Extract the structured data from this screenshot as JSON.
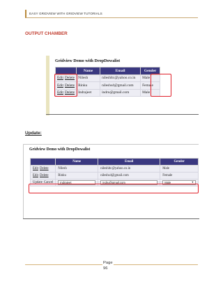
{
  "header": {
    "text": "EASY GRIDVIEW WITH GRIDVIEW TUTORIALS"
  },
  "output_section": {
    "title": "OUTPUT CHAMBER"
  },
  "update_section": {
    "title": "Update:"
  },
  "grid1": {
    "title": "Gridview Demo with DropDowalist",
    "columns": [
      "Name",
      "Email",
      "Gender"
    ],
    "rows": [
      {
        "edit": "Edit",
        "delete": "Delete",
        "name": "Nilesh",
        "email": "nileshltc@yahoo.co.in",
        "gender": "Male"
      },
      {
        "edit": "Edit",
        "delete": "Delete",
        "name": "Rinku",
        "email": "nileshs4@gmail.com",
        "gender": "Female"
      },
      {
        "edit": "Edit",
        "delete": "Delete",
        "name": "Indrajeet",
        "email": "indru@gmail.com",
        "gender": "Male"
      }
    ]
  },
  "grid2": {
    "title": "Gridview Demo with DropDowalist",
    "columns": [
      "Name",
      "Email",
      "Gender"
    ],
    "rows": [
      {
        "edit": "Edit",
        "delete": "Delete",
        "name": "Nilesh",
        "email": "nileshltc@yahoo.co.in",
        "gender": "Male"
      },
      {
        "edit": "Edit",
        "delete": "Delete",
        "name": "Rinku",
        "email": "nileshs4@gmail.com",
        "gender": "Female"
      }
    ],
    "edit_row": {
      "update": "Update",
      "cancel": "Cancel",
      "name": "Indrajeet",
      "email": "indru@gmail.com",
      "gender": "Male"
    }
  },
  "footer": {
    "page_label": "Page",
    "page_number": "96"
  },
  "colors": {
    "grid_header": "#3a3880",
    "highlight": "#e0202a",
    "accent_rule": "#d5b47a",
    "title_red": "#c0392b"
  }
}
